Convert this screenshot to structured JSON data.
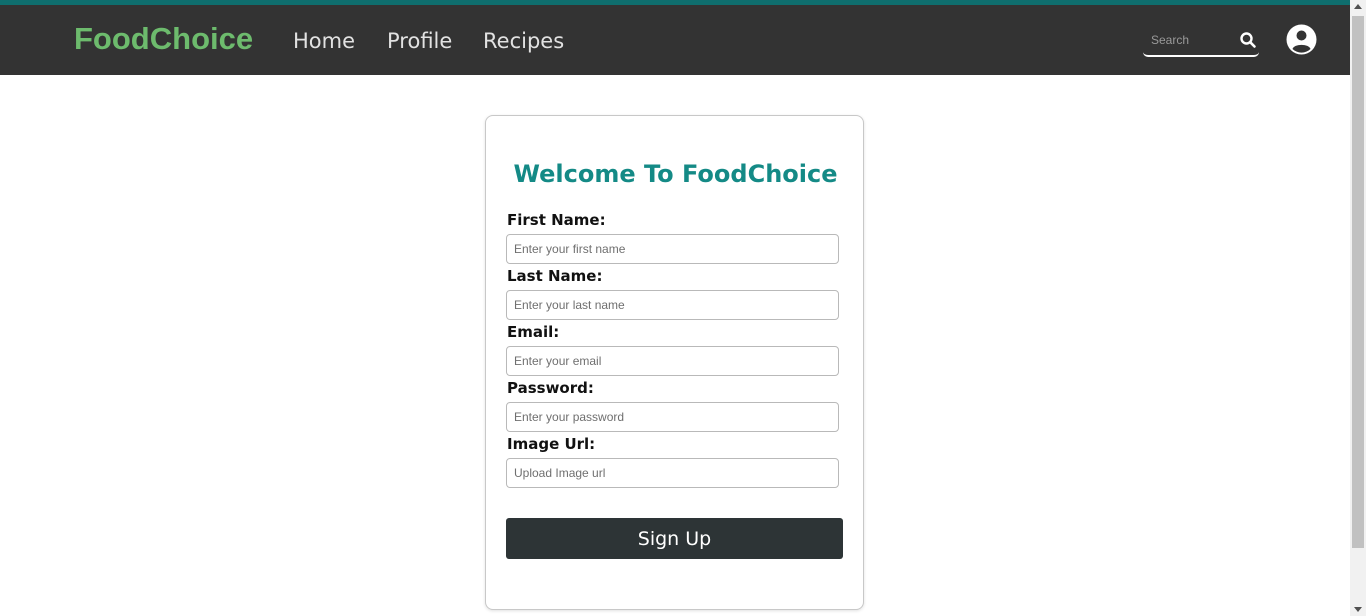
{
  "navbar": {
    "brand": "FoodChoice",
    "links": [
      "Home",
      "Profile",
      "Recipes"
    ],
    "search_placeholder": "Search",
    "search_icon": "search-icon",
    "avatar_icon": "user-circle-icon"
  },
  "signup": {
    "title": "Welcome To FoodChoice",
    "fields": [
      {
        "label": "First Name:",
        "placeholder": "Enter your first name",
        "value": ""
      },
      {
        "label": "Last Name:",
        "placeholder": "Enter your last name",
        "value": ""
      },
      {
        "label": "Email:",
        "placeholder": "Enter your email",
        "value": ""
      },
      {
        "label": "Password:",
        "placeholder": "Enter your password",
        "value": ""
      },
      {
        "label": "Image Url:",
        "placeholder": "Upload Image url",
        "value": ""
      }
    ],
    "submit_label": "Sign Up"
  },
  "colors": {
    "navbar_bg": "#333333",
    "brand": "#6dbb6d",
    "title": "#148a86",
    "button_bg": "#2d3436",
    "top_accent": "#0f6e6e"
  }
}
